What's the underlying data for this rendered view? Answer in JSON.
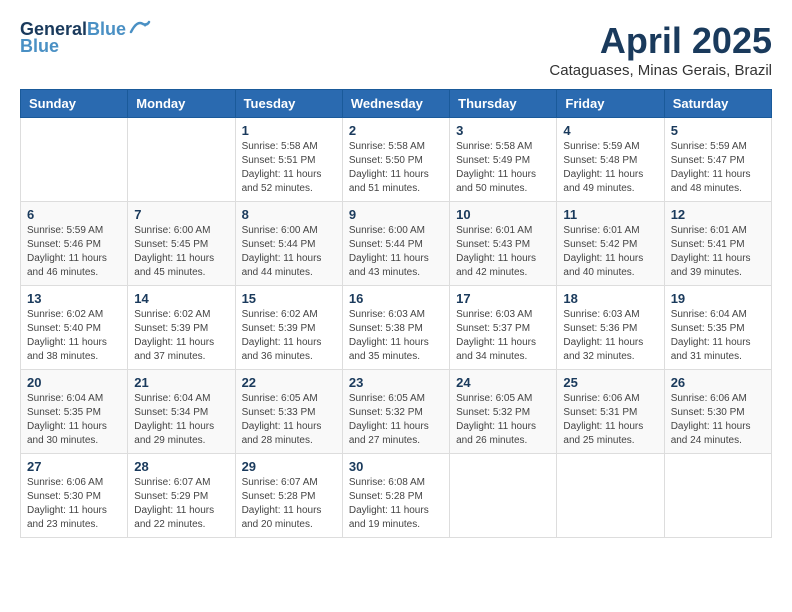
{
  "logo": {
    "line1": "General",
    "line2": "Blue"
  },
  "title": "April 2025",
  "location": "Cataguases, Minas Gerais, Brazil",
  "days_of_week": [
    "Sunday",
    "Monday",
    "Tuesday",
    "Wednesday",
    "Thursday",
    "Friday",
    "Saturday"
  ],
  "weeks": [
    [
      {
        "day": "",
        "info": ""
      },
      {
        "day": "",
        "info": ""
      },
      {
        "day": "1",
        "info": "Sunrise: 5:58 AM\nSunset: 5:51 PM\nDaylight: 11 hours and 52 minutes."
      },
      {
        "day": "2",
        "info": "Sunrise: 5:58 AM\nSunset: 5:50 PM\nDaylight: 11 hours and 51 minutes."
      },
      {
        "day": "3",
        "info": "Sunrise: 5:58 AM\nSunset: 5:49 PM\nDaylight: 11 hours and 50 minutes."
      },
      {
        "day": "4",
        "info": "Sunrise: 5:59 AM\nSunset: 5:48 PM\nDaylight: 11 hours and 49 minutes."
      },
      {
        "day": "5",
        "info": "Sunrise: 5:59 AM\nSunset: 5:47 PM\nDaylight: 11 hours and 48 minutes."
      }
    ],
    [
      {
        "day": "6",
        "info": "Sunrise: 5:59 AM\nSunset: 5:46 PM\nDaylight: 11 hours and 46 minutes."
      },
      {
        "day": "7",
        "info": "Sunrise: 6:00 AM\nSunset: 5:45 PM\nDaylight: 11 hours and 45 minutes."
      },
      {
        "day": "8",
        "info": "Sunrise: 6:00 AM\nSunset: 5:44 PM\nDaylight: 11 hours and 44 minutes."
      },
      {
        "day": "9",
        "info": "Sunrise: 6:00 AM\nSunset: 5:44 PM\nDaylight: 11 hours and 43 minutes."
      },
      {
        "day": "10",
        "info": "Sunrise: 6:01 AM\nSunset: 5:43 PM\nDaylight: 11 hours and 42 minutes."
      },
      {
        "day": "11",
        "info": "Sunrise: 6:01 AM\nSunset: 5:42 PM\nDaylight: 11 hours and 40 minutes."
      },
      {
        "day": "12",
        "info": "Sunrise: 6:01 AM\nSunset: 5:41 PM\nDaylight: 11 hours and 39 minutes."
      }
    ],
    [
      {
        "day": "13",
        "info": "Sunrise: 6:02 AM\nSunset: 5:40 PM\nDaylight: 11 hours and 38 minutes."
      },
      {
        "day": "14",
        "info": "Sunrise: 6:02 AM\nSunset: 5:39 PM\nDaylight: 11 hours and 37 minutes."
      },
      {
        "day": "15",
        "info": "Sunrise: 6:02 AM\nSunset: 5:39 PM\nDaylight: 11 hours and 36 minutes."
      },
      {
        "day": "16",
        "info": "Sunrise: 6:03 AM\nSunset: 5:38 PM\nDaylight: 11 hours and 35 minutes."
      },
      {
        "day": "17",
        "info": "Sunrise: 6:03 AM\nSunset: 5:37 PM\nDaylight: 11 hours and 34 minutes."
      },
      {
        "day": "18",
        "info": "Sunrise: 6:03 AM\nSunset: 5:36 PM\nDaylight: 11 hours and 32 minutes."
      },
      {
        "day": "19",
        "info": "Sunrise: 6:04 AM\nSunset: 5:35 PM\nDaylight: 11 hours and 31 minutes."
      }
    ],
    [
      {
        "day": "20",
        "info": "Sunrise: 6:04 AM\nSunset: 5:35 PM\nDaylight: 11 hours and 30 minutes."
      },
      {
        "day": "21",
        "info": "Sunrise: 6:04 AM\nSunset: 5:34 PM\nDaylight: 11 hours and 29 minutes."
      },
      {
        "day": "22",
        "info": "Sunrise: 6:05 AM\nSunset: 5:33 PM\nDaylight: 11 hours and 28 minutes."
      },
      {
        "day": "23",
        "info": "Sunrise: 6:05 AM\nSunset: 5:32 PM\nDaylight: 11 hours and 27 minutes."
      },
      {
        "day": "24",
        "info": "Sunrise: 6:05 AM\nSunset: 5:32 PM\nDaylight: 11 hours and 26 minutes."
      },
      {
        "day": "25",
        "info": "Sunrise: 6:06 AM\nSunset: 5:31 PM\nDaylight: 11 hours and 25 minutes."
      },
      {
        "day": "26",
        "info": "Sunrise: 6:06 AM\nSunset: 5:30 PM\nDaylight: 11 hours and 24 minutes."
      }
    ],
    [
      {
        "day": "27",
        "info": "Sunrise: 6:06 AM\nSunset: 5:30 PM\nDaylight: 11 hours and 23 minutes."
      },
      {
        "day": "28",
        "info": "Sunrise: 6:07 AM\nSunset: 5:29 PM\nDaylight: 11 hours and 22 minutes."
      },
      {
        "day": "29",
        "info": "Sunrise: 6:07 AM\nSunset: 5:28 PM\nDaylight: 11 hours and 20 minutes."
      },
      {
        "day": "30",
        "info": "Sunrise: 6:08 AM\nSunset: 5:28 PM\nDaylight: 11 hours and 19 minutes."
      },
      {
        "day": "",
        "info": ""
      },
      {
        "day": "",
        "info": ""
      },
      {
        "day": "",
        "info": ""
      }
    ]
  ]
}
